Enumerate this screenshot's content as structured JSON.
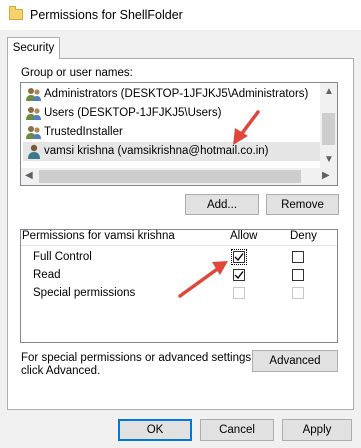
{
  "window": {
    "title": "Permissions for ShellFolder",
    "icon": "folder-icon"
  },
  "tabs": [
    {
      "label": "Security"
    }
  ],
  "group_section": {
    "label": "Group or user names:",
    "users": [
      {
        "name": "Administrators (DESKTOP-1JFJKJ5\\Administrators)",
        "icon": "user-group-icon",
        "selected": false
      },
      {
        "name": "Users (DESKTOP-1JFJKJ5\\Users)",
        "icon": "user-group-icon",
        "selected": false
      },
      {
        "name": "TrustedInstaller",
        "icon": "user-group-icon",
        "selected": false
      },
      {
        "name": "vamsi krishna (vamsikrishna@hotmail.co.in)",
        "icon": "user-icon",
        "selected": true
      }
    ],
    "add_button": "Add...",
    "remove_button": "Remove"
  },
  "permissions": {
    "header": "Permissions for vamsi krishna",
    "allow_header": "Allow",
    "deny_header": "Deny",
    "rows": [
      {
        "name": "Full Control",
        "allow": true,
        "deny": false,
        "disabled": false
      },
      {
        "name": "Read",
        "allow": true,
        "deny": false,
        "disabled": false
      },
      {
        "name": "Special permissions",
        "allow": false,
        "deny": false,
        "disabled": true
      }
    ]
  },
  "advanced": {
    "text_line1": "For special permissions or advanced settings,",
    "text_line2": "click Advanced.",
    "button": "Advanced"
  },
  "footer": {
    "ok": "OK",
    "cancel": "Cancel",
    "apply": "Apply"
  },
  "colors": {
    "accent_border": "#0078d7",
    "annotation_arrow": "#e0473a",
    "selection": "#e5e5e5"
  }
}
